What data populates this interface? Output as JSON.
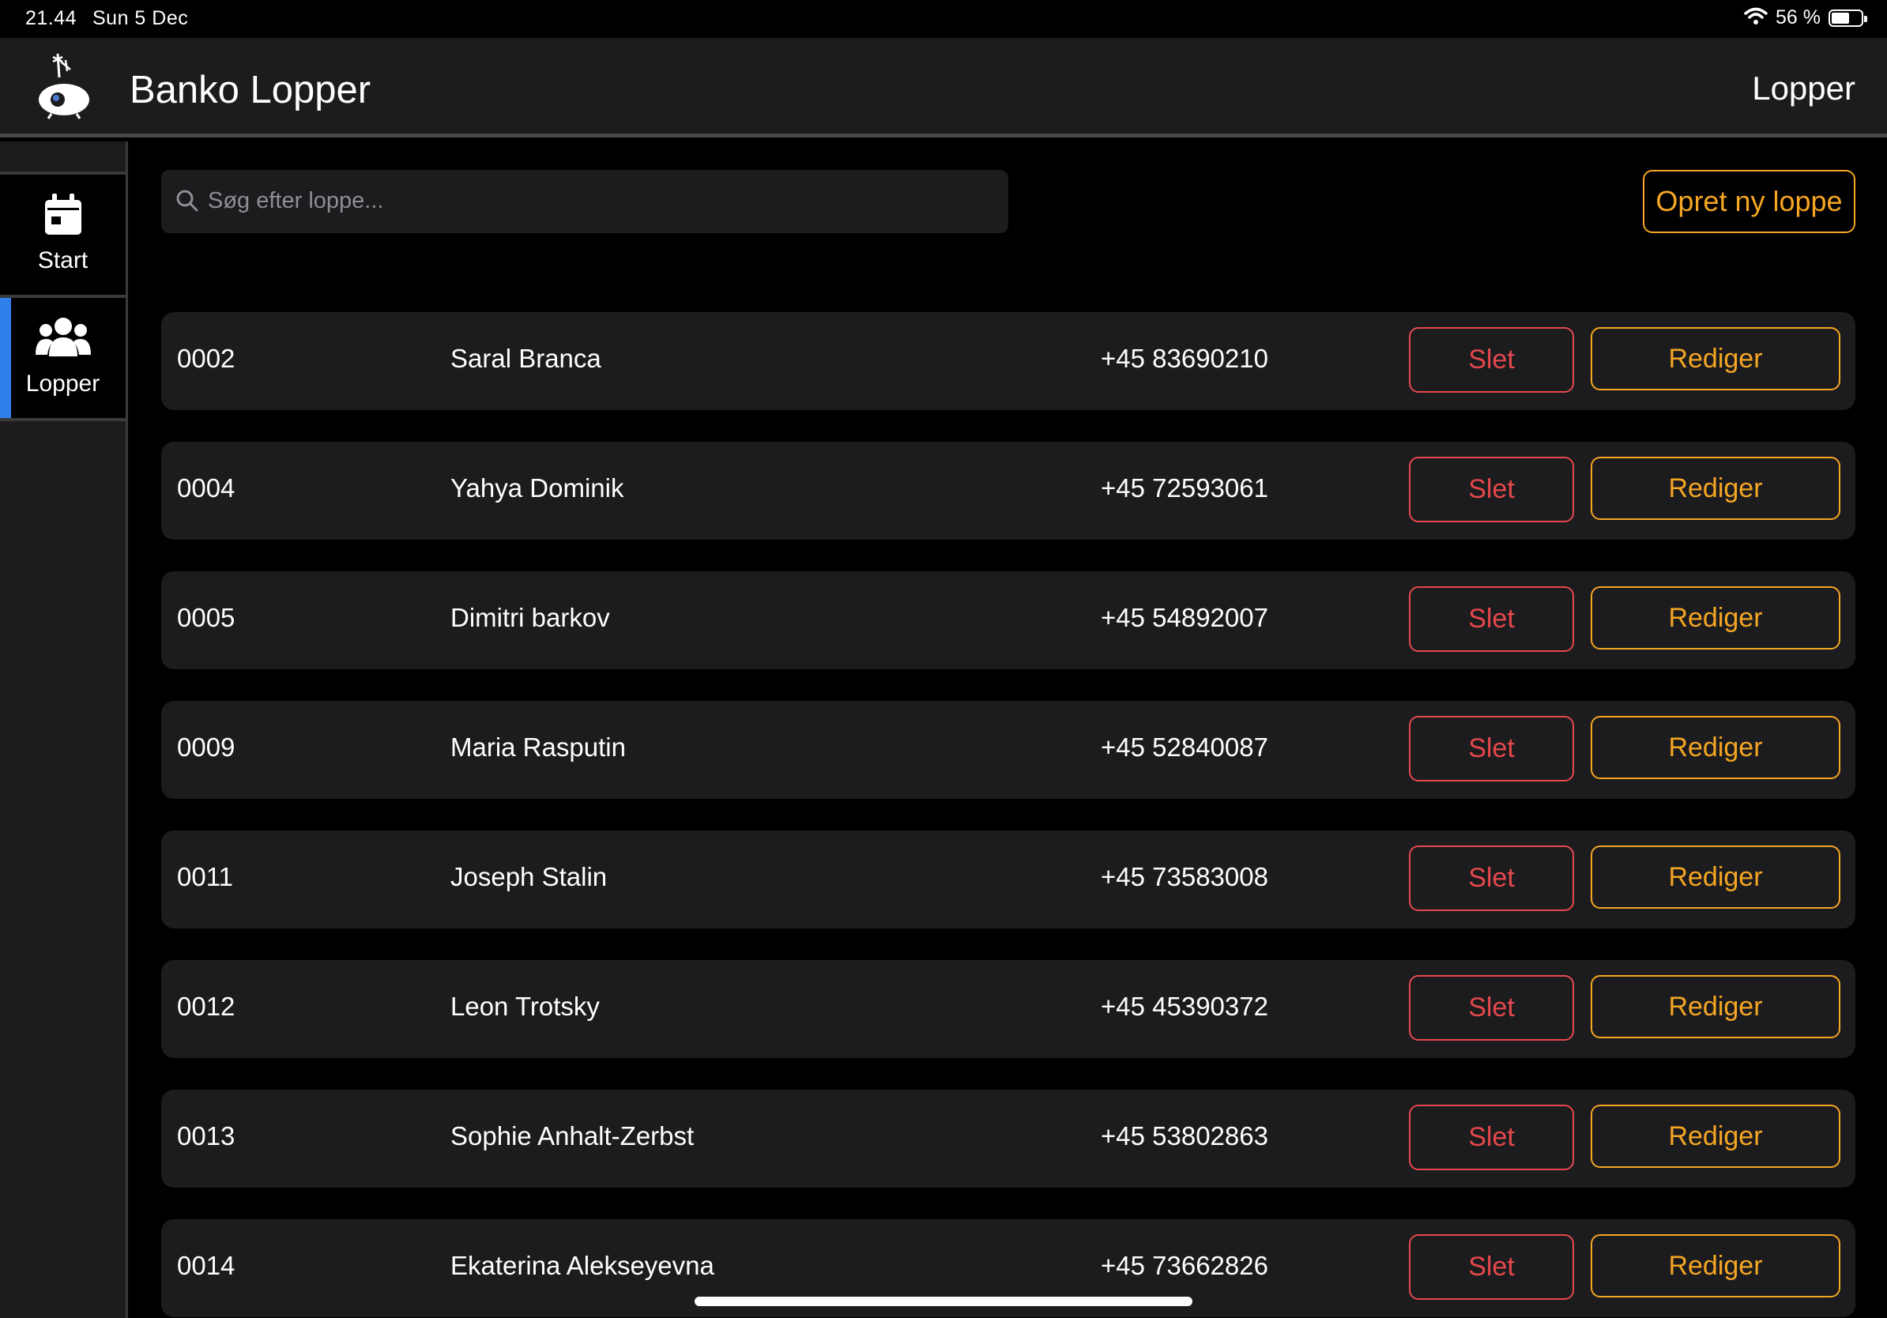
{
  "status_bar": {
    "time": "21.44",
    "date": "Sun 5 Dec",
    "battery_text": "56 %",
    "battery_level": 0.56,
    "icons": [
      "wifi-icon",
      "battery-icon"
    ]
  },
  "header": {
    "title": "Banko Lopper",
    "page_title": "Lopper",
    "logo_icon": "eye-creature-logo"
  },
  "sidebar": {
    "items": [
      {
        "label": "Start",
        "icon": "calendar-icon",
        "active": false
      },
      {
        "label": "Lopper",
        "icon": "users-icon",
        "active": true
      }
    ]
  },
  "search": {
    "placeholder": "Søg efter loppe...",
    "icon": "search-icon"
  },
  "toolbar": {
    "create_label": "Opret ny loppe"
  },
  "rows": [
    {
      "number": "0002",
      "name": "Saral Branca",
      "phone": "+45 83690210",
      "delete_label": "Slet",
      "edit_label": "Rediger"
    },
    {
      "number": "0004",
      "name": "Yahya Dominik",
      "phone": "+45 72593061",
      "delete_label": "Slet",
      "edit_label": "Rediger"
    },
    {
      "number": "0005",
      "name": "Dimitri barkov",
      "phone": "+45 54892007",
      "delete_label": "Slet",
      "edit_label": "Rediger"
    },
    {
      "number": "0009",
      "name": "Maria Rasputin",
      "phone": "+45 52840087",
      "delete_label": "Slet",
      "edit_label": "Rediger"
    },
    {
      "number": "0011",
      "name": "Joseph Stalin",
      "phone": "+45 73583008",
      "delete_label": "Slet",
      "edit_label": "Rediger"
    },
    {
      "number": "0012",
      "name": "Leon Trotsky",
      "phone": "+45 45390372",
      "delete_label": "Slet",
      "edit_label": "Rediger"
    },
    {
      "number": "0013",
      "name": "Sophie Anhalt-Zerbst",
      "phone": "+45 53802863",
      "delete_label": "Slet",
      "edit_label": "Rediger"
    },
    {
      "number": "0014",
      "name": "Ekaterina Alekseyevna",
      "phone": "+45 73662826",
      "delete_label": "Slet",
      "edit_label": "Rediger"
    }
  ],
  "colors": {
    "background": "#000000",
    "surface": "#1c1c1e",
    "accent_orange": "#f5a623",
    "danger_red": "#e5484d",
    "active_indicator": "#2f80ed"
  }
}
